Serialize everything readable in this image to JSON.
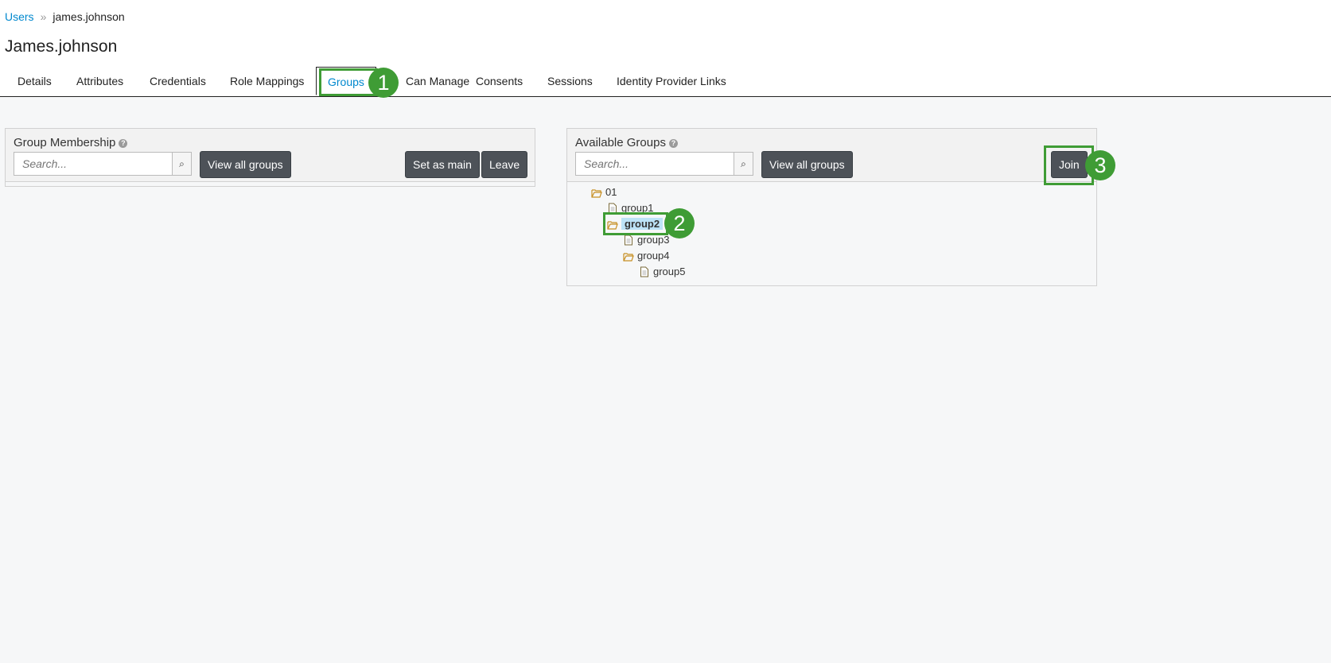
{
  "breadcrumb": {
    "root": "Users",
    "separator": "»",
    "current": "james.johnson"
  },
  "page_title": "James.johnson",
  "tabs": [
    {
      "label": "Details"
    },
    {
      "label": "Attributes"
    },
    {
      "label": "Credentials"
    },
    {
      "label": "Role Mappings"
    },
    {
      "label": "Groups"
    },
    {
      "label": "Can Manage"
    },
    {
      "label": "Consents"
    },
    {
      "label": "Sessions"
    },
    {
      "label": "Identity Provider Links"
    }
  ],
  "active_tab": "Groups",
  "membership": {
    "title": "Group Membership",
    "search_placeholder": "Search...",
    "view_all_label": "View all groups",
    "set_main_label": "Set as main",
    "leave_label": "Leave"
  },
  "available": {
    "title": "Available Groups",
    "search_placeholder": "Search...",
    "view_all_label": "View all groups",
    "join_label": "Join",
    "tree": [
      {
        "label": "01",
        "icon": "folder-open-icon"
      },
      {
        "label": "group1",
        "icon": "file-icon"
      },
      {
        "label": "group2",
        "icon": "folder-open-icon",
        "selected": true
      },
      {
        "label": "group3",
        "icon": "file-icon"
      },
      {
        "label": "group4",
        "icon": "folder-open-icon"
      },
      {
        "label": "group5",
        "icon": "file-icon"
      }
    ]
  },
  "callouts": [
    "1",
    "2",
    "3"
  ],
  "colors": {
    "link": "#0088ce",
    "button": "#4d5258",
    "callout": "#3f9c35",
    "selection": "#bde3f7",
    "folder": "#c78f23"
  }
}
